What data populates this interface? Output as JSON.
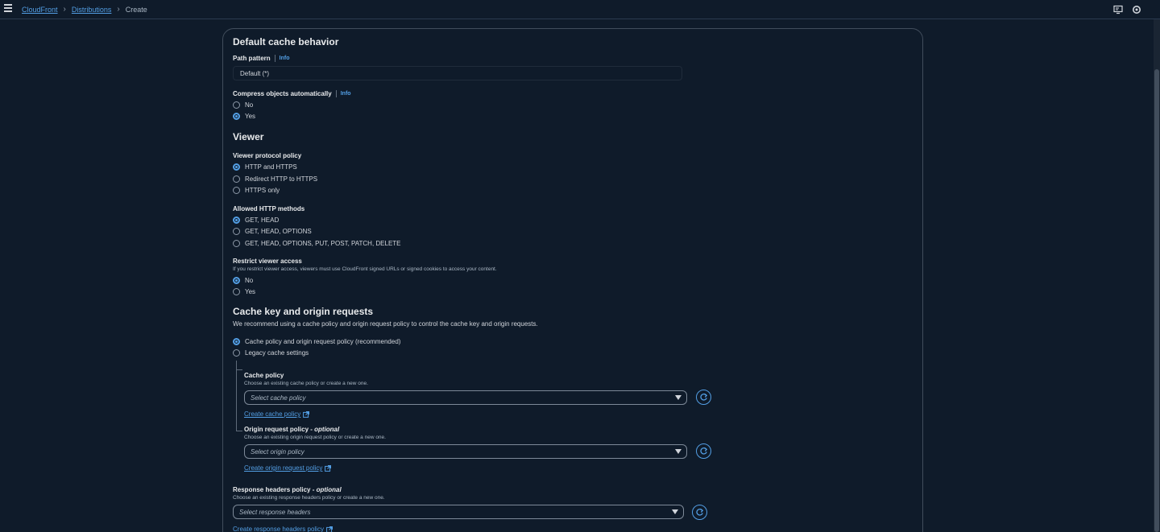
{
  "breadcrumb": {
    "root": "CloudFront",
    "section": "Distributions",
    "current": "Create"
  },
  "colors": {
    "background": "#0f1b2a",
    "accent": "#539fe5",
    "border": "#414d5c",
    "text": "#d1d5db"
  },
  "section_title": "Default cache behavior",
  "path_pattern": {
    "label": "Path pattern",
    "info": "Info",
    "value": "Default (*)"
  },
  "compress": {
    "label": "Compress objects automatically",
    "info": "Info",
    "options": [
      "No",
      "Yes"
    ],
    "selected": "Yes"
  },
  "viewer": {
    "title": "Viewer",
    "protocol": {
      "label": "Viewer protocol policy",
      "options": [
        "HTTP and HTTPS",
        "Redirect HTTP to HTTPS",
        "HTTPS only"
      ],
      "selected": "HTTP and HTTPS"
    },
    "methods": {
      "label": "Allowed HTTP methods",
      "options": [
        "GET, HEAD",
        "GET, HEAD, OPTIONS",
        "GET, HEAD, OPTIONS, PUT, POST, PATCH, DELETE"
      ],
      "selected": "GET, HEAD"
    },
    "restrict": {
      "label": "Restrict viewer access",
      "description": "If you restrict viewer access, viewers must use CloudFront signed URLs or signed cookies to access your content.",
      "options": [
        "No",
        "Yes"
      ],
      "selected": "No"
    }
  },
  "cache_key": {
    "title": "Cache key and origin requests",
    "description": "We recommend using a cache policy and origin request policy to control the cache key and origin requests.",
    "options": [
      "Cache policy and origin request policy (recommended)",
      "Legacy cache settings"
    ],
    "selected": "Cache policy and origin request policy (recommended)",
    "cache_policy": {
      "label": "Cache policy",
      "description": "Choose an existing cache policy or create a new one.",
      "placeholder": "Select cache policy",
      "create_link": "Create cache policy"
    },
    "origin_policy": {
      "label": "Origin request policy - ",
      "optional": "optional",
      "description": "Choose an existing origin request policy or create a new one.",
      "placeholder": "Select origin policy",
      "create_link": "Create origin request policy"
    }
  },
  "response_headers": {
    "label": "Response headers policy - ",
    "optional": "optional",
    "description": "Choose an existing response headers policy or create a new one.",
    "placeholder": "Select response headers",
    "create_link": "Create response headers policy"
  },
  "icons": {
    "menu": "hamburger-icon",
    "notifications": "notifications-icon",
    "settings": "settings-icon",
    "refresh": "refresh-icon",
    "external": "external-link-icon",
    "caret": "caret-down-icon"
  }
}
